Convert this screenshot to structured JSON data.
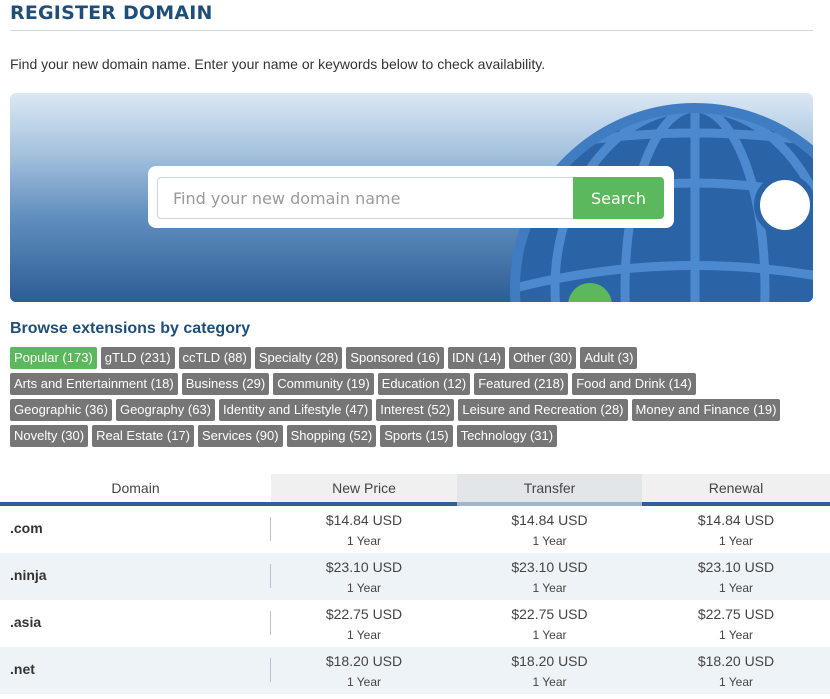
{
  "page": {
    "title": "REGISTER DOMAIN",
    "intro": "Find your new domain name. Enter your name or keywords below to check availability."
  },
  "search": {
    "placeholder": "Find your new domain name",
    "button_label": "Search"
  },
  "browse": {
    "heading": "Browse extensions by category",
    "rows": [
      [
        {
          "label": "Popular (173)",
          "active": true
        },
        {
          "label": "gTLD (231)"
        },
        {
          "label": "ccTLD (88)"
        },
        {
          "label": "Specialty (28)"
        },
        {
          "label": "Sponsored (16)"
        },
        {
          "label": "IDN (14)"
        },
        {
          "label": "Other (30)"
        },
        {
          "label": "Adult (3)"
        }
      ],
      [
        {
          "label": "Arts and Entertainment (18)"
        },
        {
          "label": "Business (29)"
        },
        {
          "label": "Community (19)"
        },
        {
          "label": "Education (12)"
        },
        {
          "label": "Featured (218)"
        },
        {
          "label": "Food and Drink (14)"
        }
      ],
      [
        {
          "label": "Geographic (36)"
        },
        {
          "label": "Geography (63)"
        },
        {
          "label": "Identity and Lifestyle (47)"
        },
        {
          "label": "Interest (52)"
        },
        {
          "label": "Leisure and Recreation (28)"
        },
        {
          "label": "Money and Finance (19)"
        }
      ],
      [
        {
          "label": "Novelty (30)"
        },
        {
          "label": "Real Estate (17)"
        },
        {
          "label": "Services (90)"
        },
        {
          "label": "Shopping (52)"
        },
        {
          "label": "Sports (15)"
        },
        {
          "label": "Technology (31)"
        }
      ]
    ]
  },
  "table": {
    "headers": {
      "domain": "Domain",
      "new_price": "New Price",
      "transfer": "Transfer",
      "renewal": "Renewal"
    },
    "rows": [
      {
        "tld": ".com",
        "new_price": "$14.84 USD",
        "transfer": "$14.84 USD",
        "renewal": "$14.84 USD",
        "term": "1 Year"
      },
      {
        "tld": ".ninja",
        "new_price": "$23.10 USD",
        "transfer": "$23.10 USD",
        "renewal": "$23.10 USD",
        "term": "1 Year"
      },
      {
        "tld": ".asia",
        "new_price": "$22.75 USD",
        "transfer": "$22.75 USD",
        "renewal": "$22.75 USD",
        "term": "1 Year"
      },
      {
        "tld": ".net",
        "new_price": "$18.20 USD",
        "transfer": "$18.20 USD",
        "renewal": "$18.20 USD",
        "term": "1 Year"
      }
    ]
  },
  "colors": {
    "title": "#1f4e79",
    "accent_green": "#5cb85c",
    "chip_gray": "#767676",
    "table_bar": "#2f5f96"
  },
  "icons": {
    "hero": "globe-icon"
  }
}
